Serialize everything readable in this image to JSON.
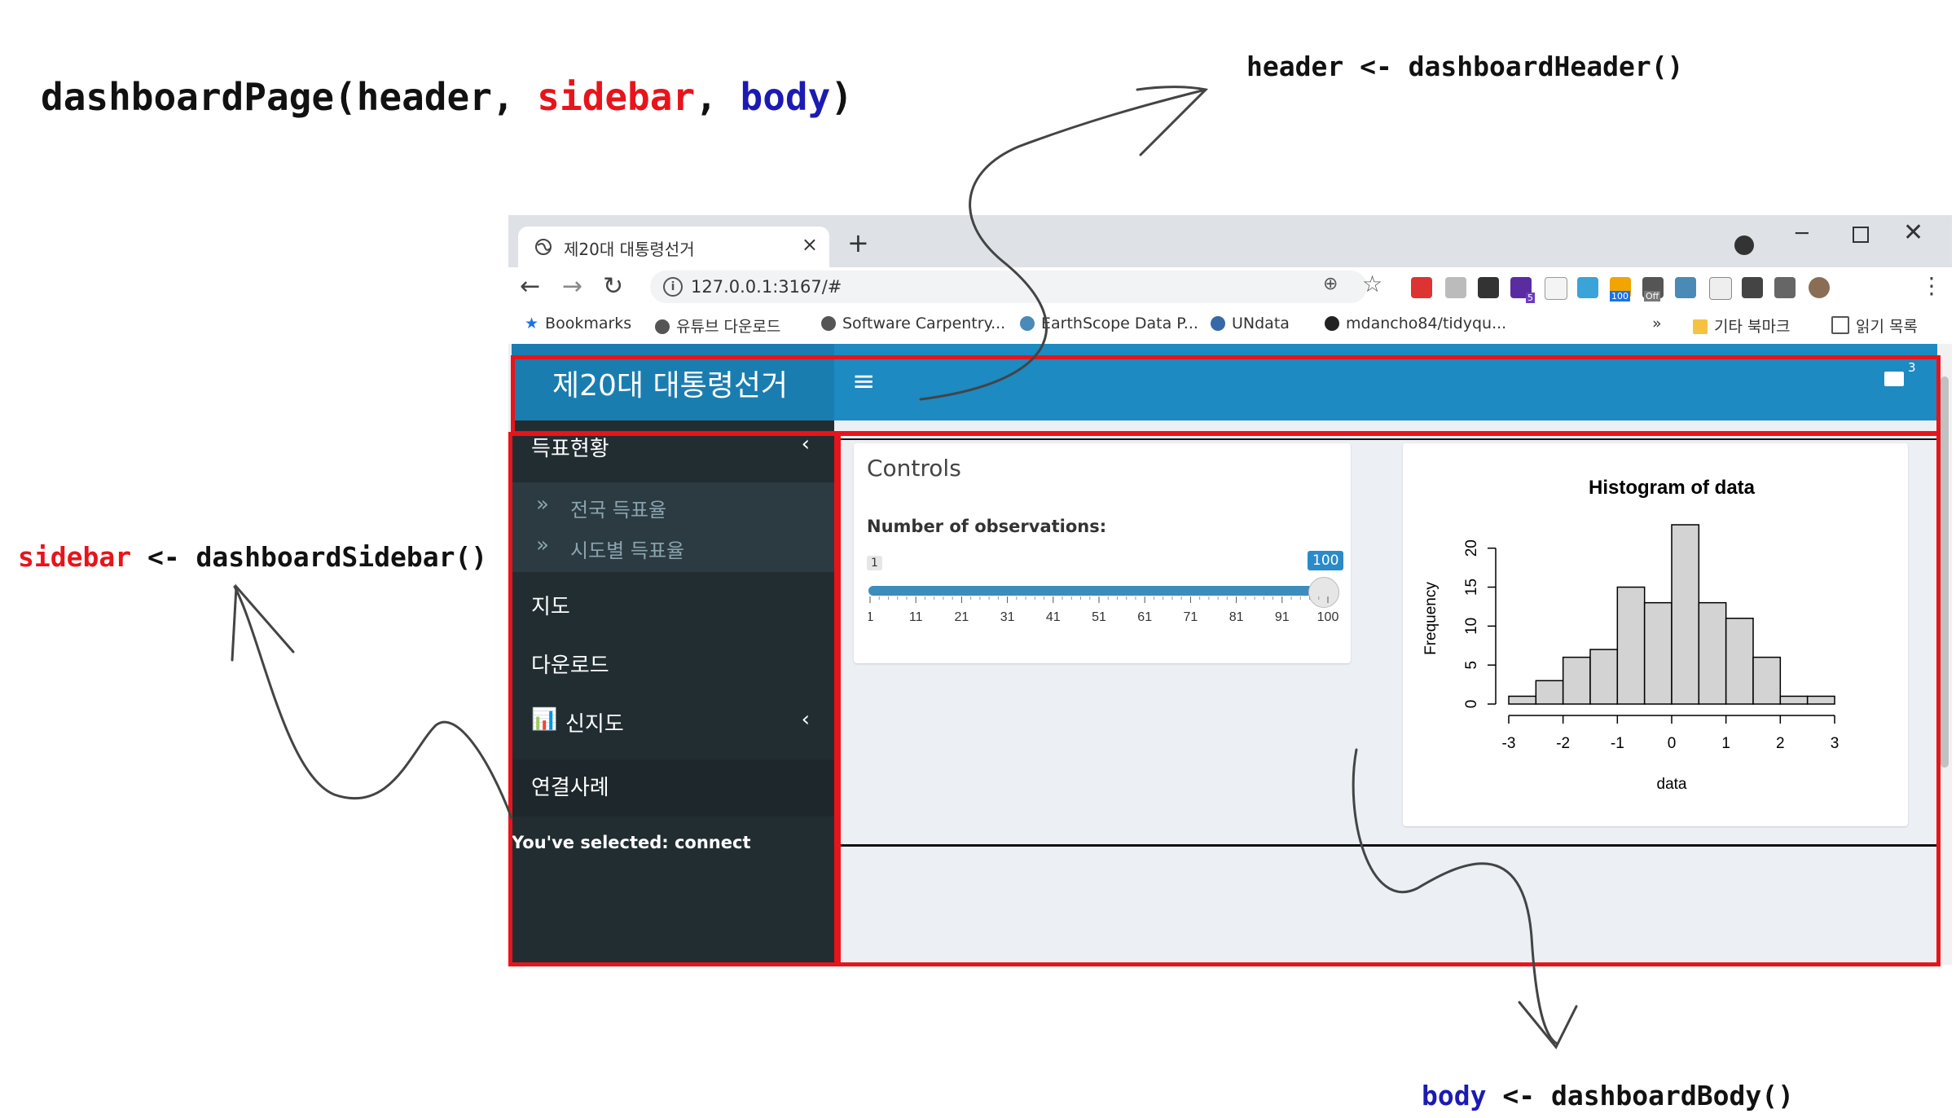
{
  "annotations": {
    "main_code": {
      "prefix": "dashboardPage(header, ",
      "sidebar": "sidebar",
      "sep": ", ",
      "body": "body",
      "suffix": ")"
    },
    "header_code": "header <- dashboardHeader()",
    "sidebar_code": {
      "var": "sidebar",
      "rest": " <- dashboardSidebar()"
    },
    "body_code": {
      "var": "body",
      "rest": " <- dashboardBody()"
    }
  },
  "browser": {
    "tab_title": "제20대 대통령선거",
    "tab_close": "×",
    "new_tab": "+",
    "url": "127.0.0.1:3167/#",
    "window": {
      "minimize": "─",
      "close": "✕"
    },
    "extension_badges": {
      "badge_5": "5",
      "badge_100": "100",
      "badge_off": "Off"
    },
    "bookmarks": [
      {
        "label": "Bookmarks",
        "icon": "star-icon"
      },
      {
        "label": "유튜브 다운로드",
        "icon": "globe-icon"
      },
      {
        "label": "Software Carpentry...",
        "icon": "globe-icon"
      },
      {
        "label": "EarthScope Data P...",
        "icon": "globe-icon"
      },
      {
        "label": "UNdata",
        "icon": "un-icon"
      },
      {
        "label": "mdancho84/tidyqu...",
        "icon": "github-icon"
      }
    ],
    "bookmarks_more": "»",
    "other_bookmarks": "기타 북마크",
    "reading_list": "읽기 목록"
  },
  "app": {
    "title": "제20대 대통령선거",
    "mail_badge": "3",
    "sidebar": {
      "items": [
        {
          "label": "득표현황",
          "has_children": true
        },
        {
          "label": "지도"
        },
        {
          "label": "다운로드"
        },
        {
          "label": "신지도",
          "has_children": true,
          "icon": "bar-chart-icon"
        },
        {
          "label": "연결사례",
          "active": true
        }
      ],
      "sub_items": [
        {
          "label": "전국 득표율"
        },
        {
          "label": "시도별 득표율"
        }
      ],
      "selected_text": "You've selected: connect"
    },
    "controls": {
      "title": "Controls",
      "label": "Number of observations:",
      "min": "1",
      "max": "100",
      "value_fraction": 1.0,
      "ticks": [
        "1",
        "11",
        "21",
        "31",
        "41",
        "51",
        "61",
        "71",
        "81",
        "91",
        "100"
      ]
    }
  },
  "chart_data": {
    "type": "bar",
    "title": "Histogram of data",
    "xlabel": "data",
    "ylabel": "Frequency",
    "bins": [
      -3,
      -2.5,
      -2,
      -1.5,
      -1,
      -0.5,
      0,
      0.5,
      1,
      1.5,
      2,
      2.5,
      3
    ],
    "values": [
      1,
      3,
      6,
      7,
      15,
      13,
      23,
      13,
      11,
      6,
      1,
      1
    ],
    "xlim": [
      -3,
      3
    ],
    "ylim": [
      0,
      23
    ],
    "xticks": [
      "-3",
      "-2",
      "-1",
      "0",
      "1",
      "2",
      "3"
    ],
    "yticks": [
      "0",
      "5",
      "10",
      "15",
      "20"
    ],
    "bar_color": "#d3d3d3"
  },
  "colors": {
    "header": "#1d8ac2",
    "sidebar": "#222d32",
    "body": "#ecf0f5",
    "highlight": "#e8141b"
  }
}
